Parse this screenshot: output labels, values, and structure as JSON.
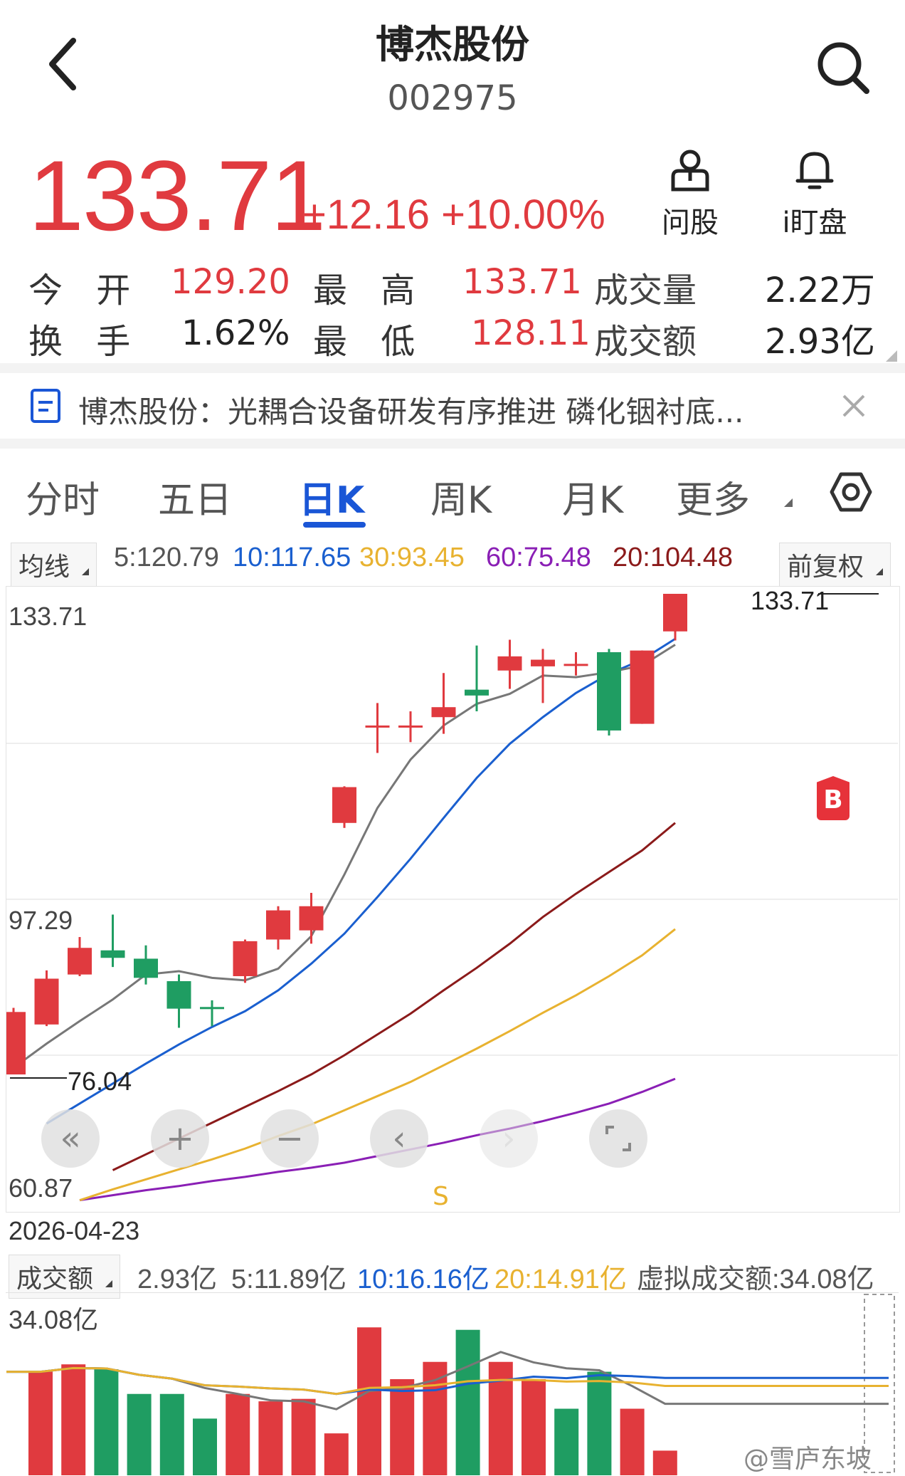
{
  "header": {
    "title": "博杰股份",
    "code": "002975"
  },
  "quote": {
    "price": "133.71",
    "change": "+12.16",
    "change_pct": "+10.00%",
    "ask_label": "问股",
    "watch_label": "i盯盘"
  },
  "stats": {
    "open_label": "今 开",
    "open": "129.20",
    "high_label": "最 高",
    "high": "133.71",
    "volume_label": "成交量",
    "volume": "2.22万",
    "turnover_label": "换 手",
    "turnover": "1.62%",
    "low_label": "最 低",
    "low": "128.11",
    "amount_label": "成交额",
    "amount": "2.93亿"
  },
  "news": {
    "text": "博杰股份：光耦合设备研发有序推进 磷化铟衬底..."
  },
  "tabs": [
    "分时",
    "五日",
    "日K",
    "周K",
    "月K",
    "更多"
  ],
  "ma": {
    "label": "均线",
    "ma5": "5:120.79",
    "ma10": "10:117.65",
    "ma30": "30:93.45",
    "ma60": "60:75.48",
    "ma20": "20:104.48",
    "adjust": "前复权"
  },
  "chart": {
    "max_label": "133.71",
    "mid_label": "97.29",
    "min_label": "60.87",
    "high_marker": "133.71",
    "low_marker": "76.04",
    "date": "2026-04-23",
    "buy_tag": "B",
    "sell_tag": "S"
  },
  "volume": {
    "label": "成交额",
    "value": "2.93亿",
    "ma5": "5:11.89亿",
    "ma10": "10:16.16亿",
    "ma20": "20:14.91亿",
    "virtual": "虚拟成交额:34.08亿",
    "max_label": "34.08亿"
  },
  "watermark": "@雪庐东坡",
  "colors": {
    "up": "#e03a3f",
    "down": "#1f9d62",
    "ma5": "#777777",
    "ma10": "#1a5fcf",
    "ma20": "#8b1a1a",
    "ma30": "#e8b230",
    "ma60": "#8a1fb5",
    "accent": "#1a56d6"
  },
  "chart_data": {
    "type": "candlestick",
    "ylim": [
      60.87,
      133.71
    ],
    "ticks": [
      133.71,
      97.29,
      60.87
    ],
    "candles": [
      {
        "o": 76.0,
        "h": 84.0,
        "l": 76.04,
        "c": 83.5,
        "up": true
      },
      {
        "o": 82.0,
        "h": 88.5,
        "l": 81.8,
        "c": 87.5,
        "up": true
      },
      {
        "o": 88.0,
        "h": 92.5,
        "l": 87.8,
        "c": 91.2,
        "up": true
      },
      {
        "o": 90.9,
        "h": 95.2,
        "l": 88.9,
        "c": 90.0,
        "up": false
      },
      {
        "o": 89.9,
        "h": 91.5,
        "l": 86.8,
        "c": 87.6,
        "up": false
      },
      {
        "o": 87.2,
        "h": 88.0,
        "l": 81.6,
        "c": 83.9,
        "up": false
      },
      {
        "o": 84.1,
        "h": 84.9,
        "l": 81.8,
        "c": 83.9,
        "up": false
      },
      {
        "o": 87.8,
        "h": 92.2,
        "l": 87.0,
        "c": 92.0,
        "up": true
      },
      {
        "o": 92.2,
        "h": 96.2,
        "l": 91.0,
        "c": 95.7,
        "up": true
      },
      {
        "o": 93.3,
        "h": 97.8,
        "l": 91.7,
        "c": 96.2,
        "up": true
      },
      {
        "o": 106.2,
        "h": 110.6,
        "l": 105.6,
        "c": 110.5,
        "up": true
      },
      {
        "o": 117.9,
        "h": 120.6,
        "l": 114.6,
        "c": 117.9,
        "up": true
      },
      {
        "o": 117.9,
        "h": 119.6,
        "l": 115.9,
        "c": 117.9,
        "up": true
      },
      {
        "o": 118.9,
        "h": 124.2,
        "l": 116.9,
        "c": 120.1,
        "up": true
      },
      {
        "o": 122.2,
        "h": 127.5,
        "l": 119.6,
        "c": 121.5,
        "up": false
      },
      {
        "o": 124.5,
        "h": 128.2,
        "l": 122.3,
        "c": 126.2,
        "up": true
      },
      {
        "o": 125.0,
        "h": 127.1,
        "l": 120.6,
        "c": 125.8,
        "up": true
      },
      {
        "o": 125.3,
        "h": 126.7,
        "l": 123.9,
        "c": 125.3,
        "up": true
      },
      {
        "o": 126.7,
        "h": 127.1,
        "l": 116.7,
        "c": 117.3,
        "up": false
      },
      {
        "o": 118.1,
        "h": 126.9,
        "l": 118.1,
        "c": 126.9,
        "up": true
      },
      {
        "o": 129.2,
        "h": 133.71,
        "l": 128.11,
        "c": 133.71,
        "up": true
      }
    ],
    "ma5": [
      76.8,
      79.7,
      82.4,
      85.0,
      88.0,
      88.4,
      87.6,
      87.3,
      88.7,
      92.6,
      100.0,
      108.0,
      113.8,
      117.9,
      120.5,
      121.7,
      123.9,
      123.7,
      124.3,
      125.1,
      127.6
    ],
    "ma10": [
      70.1,
      72.5,
      74.9,
      77.3,
      79.6,
      81.7,
      83.6,
      86.1,
      89.3,
      92.9,
      97.3,
      101.9,
      106.8,
      111.6,
      115.7,
      118.9,
      121.8,
      124.1,
      125.8,
      128.3
    ],
    "ma20": [
      64.5,
      66.4,
      68.3,
      70.2,
      72.1,
      74.0,
      76.0,
      78.3,
      80.8,
      83.3,
      86.1,
      88.8,
      91.7,
      94.9,
      97.7,
      100.3,
      102.9,
      106.2
    ],
    "ma30": [
      60.9,
      62.2,
      63.4,
      64.6,
      65.8,
      67.1,
      68.6,
      70.0,
      71.7,
      73.4,
      75.1,
      77.1,
      79.1,
      81.2,
      83.4,
      85.5,
      87.8,
      90.3,
      93.45
    ],
    "ma60": [
      60.9,
      61.5,
      62.1,
      62.6,
      63.2,
      63.7,
      64.3,
      64.8,
      65.4,
      66.2,
      67.0,
      67.8,
      68.7,
      69.5,
      70.4,
      71.4,
      72.5,
      73.9,
      75.48
    ],
    "volume_bars": [
      {
        "v": 21.0,
        "up": true
      },
      {
        "v": 22.5,
        "up": true
      },
      {
        "v": 21.5,
        "up": false
      },
      {
        "v": 16.5,
        "up": false
      },
      {
        "v": 16.5,
        "up": false
      },
      {
        "v": 11.5,
        "up": false
      },
      {
        "v": 16.5,
        "up": true
      },
      {
        "v": 15.0,
        "up": true
      },
      {
        "v": 15.5,
        "up": true
      },
      {
        "v": 8.5,
        "up": true
      },
      {
        "v": 30.0,
        "up": true
      },
      {
        "v": 19.5,
        "up": true
      },
      {
        "v": 23.0,
        "up": true
      },
      {
        "v": 29.5,
        "up": false
      },
      {
        "v": 23.0,
        "up": true
      },
      {
        "v": 19.5,
        "up": true
      },
      {
        "v": 13.5,
        "up": false
      },
      {
        "v": 21.0,
        "up": false
      },
      {
        "v": 13.5,
        "up": true
      },
      {
        "v": 5.0,
        "up": true
      }
    ],
    "volume_ylim": [
      0,
      34.08
    ]
  }
}
